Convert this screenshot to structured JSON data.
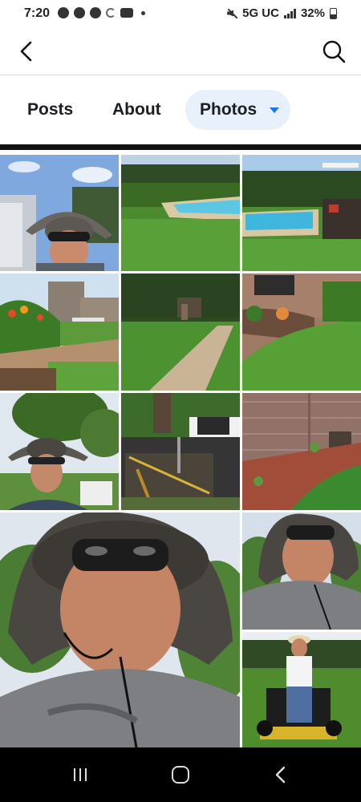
{
  "status_bar": {
    "time": "7:20",
    "network": "5G UC",
    "battery": "32%",
    "left_icons": [
      "messenger-icon",
      "facebook-icon",
      "chrome-icon",
      "sync-icon",
      "youtube-icon",
      "dot-icon"
    ]
  },
  "header": {
    "back_icon": "back-arrow-icon",
    "search_icon": "search-icon"
  },
  "tabs": [
    {
      "label": "Posts",
      "selected": false
    },
    {
      "label": "About",
      "selected": false
    },
    {
      "label": "Photos",
      "selected": true,
      "has_dropdown": true
    }
  ],
  "photos": [
    "selfie-man-hat-sunglasses-in-vehicle",
    "backyard-pool-with-lawn",
    "pool-and-lawn-with-patio",
    "flower-bed-and-lawn-by-house",
    "lawn-with-gravel-path",
    "brick-house-garden-edge",
    "man-in-hat-outdoors",
    "mower-trailer-and-truck",
    "brick-wall-with-mulch-bed",
    "large-selfie-man-in-hat",
    "selfie-man-in-hat",
    "man-on-riding-mower"
  ],
  "colors": {
    "accent": "#1877f2",
    "selected_tab_bg": "#e7f0fb",
    "nav_bar": "#000000"
  }
}
